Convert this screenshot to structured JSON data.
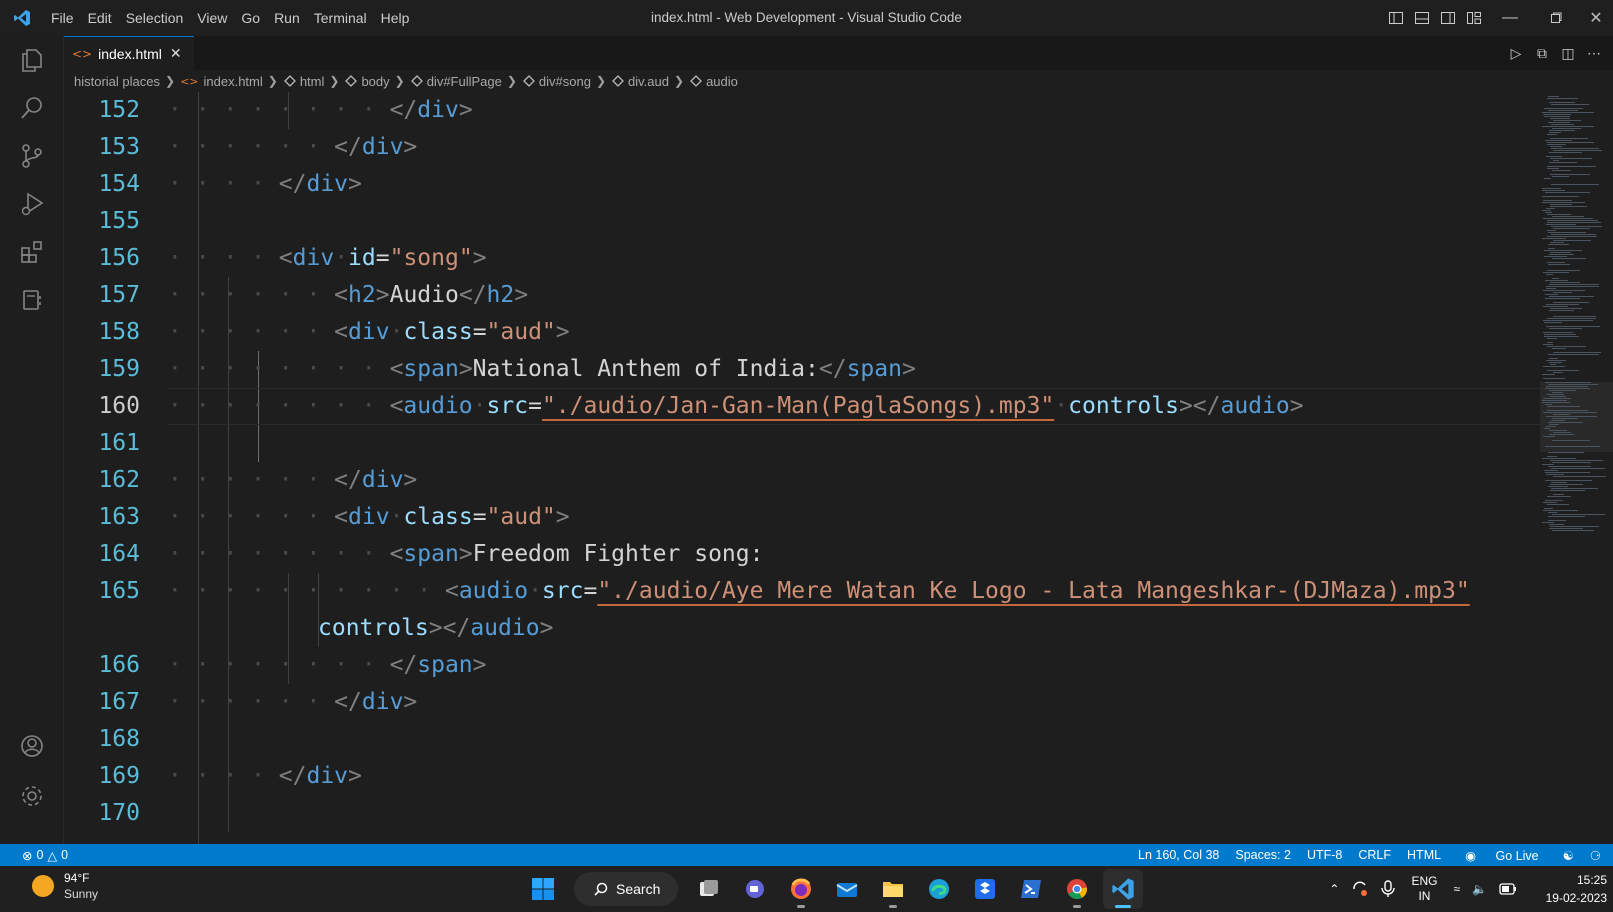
{
  "window": {
    "title": "index.html - Web Development - Visual Studio Code",
    "menu": [
      "File",
      "Edit",
      "Selection",
      "View",
      "Go",
      "Run",
      "Terminal",
      "Help"
    ]
  },
  "tabs": [
    {
      "label": "index.html",
      "active": true
    }
  ],
  "breadcrumb": [
    "historial places",
    "index.html",
    "html",
    "body",
    "div#FullPage",
    "div#song",
    "div.aud",
    "audio"
  ],
  "editor": {
    "active_line": "160",
    "lines": [
      {
        "n": "152",
        "text": "</div>"
      },
      {
        "n": "153",
        "text": "</div>"
      },
      {
        "n": "154",
        "text": "</div>"
      },
      {
        "n": "155",
        "text": ""
      },
      {
        "n": "156",
        "tag": "div",
        "attr": "id",
        "value": "\"song\""
      },
      {
        "n": "157",
        "tag_open": "h2",
        "inner": "Audio",
        "tag_close": "h2"
      },
      {
        "n": "158",
        "tag": "div",
        "attr": "class",
        "value": "\"aud\""
      },
      {
        "n": "159",
        "tag_open": "span",
        "inner": "National Anthem of India:",
        "tag_close": "span"
      },
      {
        "n": "160",
        "tag": "audio",
        "attr": "src",
        "value": "\"./audio/Jan-Gan-Man(PaglaSongs).mp3\"",
        "attr2": "controls",
        "tag_close": "audio"
      },
      {
        "n": "161",
        "text": ""
      },
      {
        "n": "162",
        "text": "</div>"
      },
      {
        "n": "163",
        "tag": "div",
        "attr": "class",
        "value": "\"aud\""
      },
      {
        "n": "164",
        "tag": "span",
        "inner": "Freedom Fighter song:"
      },
      {
        "n": "165",
        "tag": "audio",
        "attr": "src",
        "value": "\"./audio/Aye Mere Watan Ke Logo - Lata Mangeshkar-(DJMaza).mp3\""
      },
      {
        "n": "",
        "attr2": "controls",
        "tag_close": "audio"
      },
      {
        "n": "166",
        "text": "</span>"
      },
      {
        "n": "167",
        "text": "</div>"
      },
      {
        "n": "168",
        "text": ""
      },
      {
        "n": "169",
        "text": "</div>"
      },
      {
        "n": "170",
        "text": ""
      }
    ]
  },
  "status": {
    "errors": "0",
    "warnings": "0",
    "position": "Ln 160, Col 38",
    "spaces": "Spaces: 2",
    "encoding": "UTF-8",
    "eol": "CRLF",
    "language": "HTML",
    "go_live": "Go Live"
  },
  "taskbar": {
    "temperature": "94°F",
    "condition": "Sunny",
    "search": "Search",
    "lang_top": "ENG",
    "lang_bottom": "IN",
    "time": "15:25",
    "date": "19-02-2023"
  },
  "colors": {
    "accent": "#007acc",
    "tag": "#569cd6",
    "attribute": "#9cdcfe",
    "string": "#ce9178",
    "line_number": "#5bbcd8"
  }
}
